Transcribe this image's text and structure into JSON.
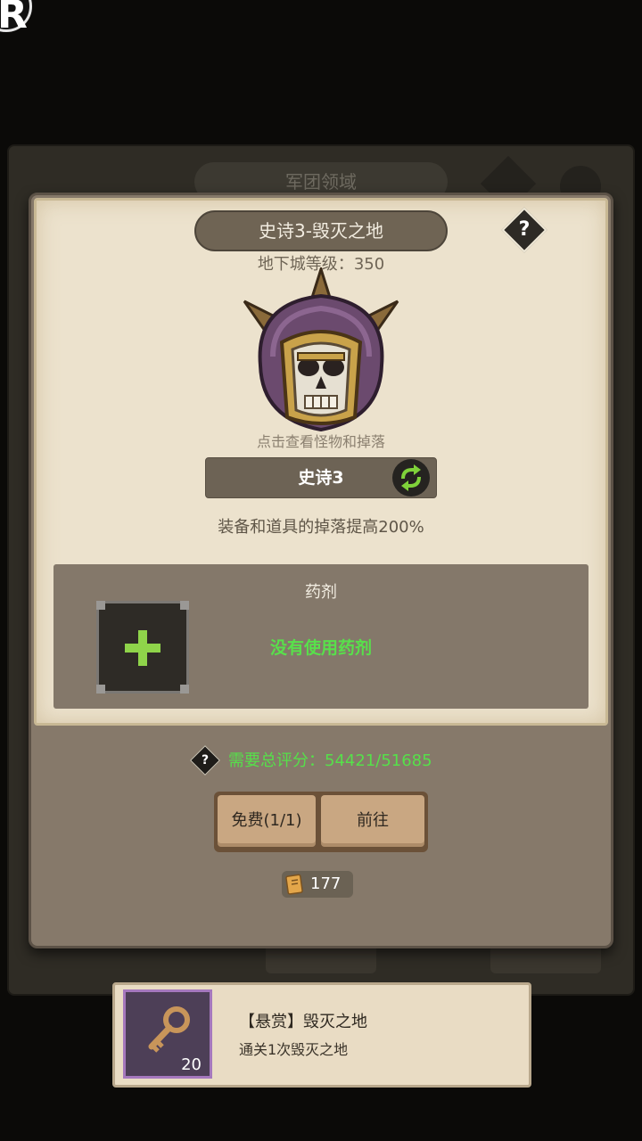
{
  "corner_badge": "R",
  "background_panel": {
    "title": "军团领域"
  },
  "dungeon": {
    "title": "史诗3-毁灭之地",
    "help_icon": "question-mark",
    "level_label": "地下城等级：",
    "level_value": "350",
    "boss_hint": "点击查看怪物和掉落",
    "difficulty": "史诗3",
    "drop_bonus": "装备和道具的掉落提高200%"
  },
  "potion": {
    "title": "药剂",
    "status": "没有使用药剂",
    "add_icon": "plus-icon"
  },
  "score": {
    "label": "需要总评分：",
    "value": "54421/51685"
  },
  "actions": {
    "free_label": "免费(1/1)",
    "go_label": "前往"
  },
  "ticket": {
    "count": "177"
  },
  "bounty": {
    "title": "【悬赏】毁灭之地",
    "description": "通关1次毁灭之地",
    "count": "20"
  },
  "colors": {
    "accent_green": "#56e04a",
    "parchment": "#ece2cd",
    "bounty_border": "#a578bd"
  }
}
